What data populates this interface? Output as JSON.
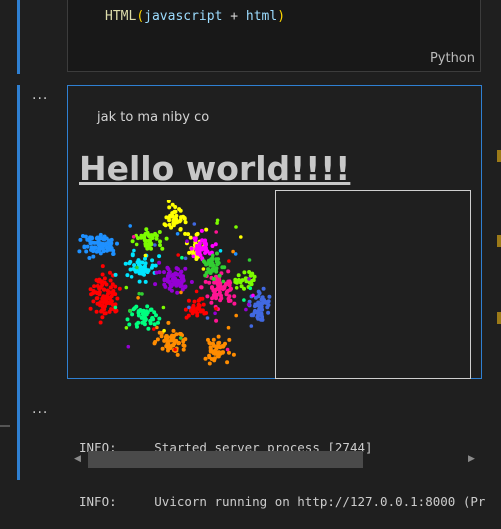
{
  "code_cell": {
    "tokens": {
      "fn": "HTML",
      "open": "(",
      "arg1": "javascript",
      "op": " + ",
      "arg2": "html",
      "close": ")"
    },
    "language": "Python"
  },
  "output_cell": {
    "paragraph": "jak to ma niby co",
    "heading": "Hello world!!!!"
  },
  "terminal": {
    "lines": [
      {
        "level": "INFO:",
        "message": "Started server process [2744]"
      },
      {
        "level": "INFO:",
        "message": "Uvicorn running on http://127.0.0.1:8000 (Pr"
      }
    ]
  },
  "toolbar": {
    "more_actions": "..."
  },
  "icons": {
    "more": "ellipsis-icon",
    "scroll_left": "chevron-left-icon",
    "scroll_right": "chevron-right-icon"
  },
  "colors": {
    "focus": "#2f80d2",
    "background": "#1f1f1f",
    "clusters": [
      "#ff0000",
      "#1e90ff",
      "#00e5ff",
      "#7cfc00",
      "#ffff00",
      "#ff1493",
      "#9400d3",
      "#ff8c00",
      "#00ff7f",
      "#4169e1",
      "#ff00ff",
      "#32cd32"
    ]
  }
}
